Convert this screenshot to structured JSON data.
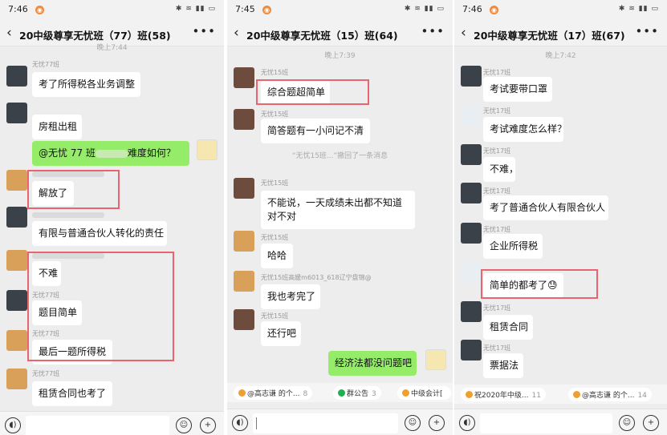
{
  "screens": [
    {
      "status_time": "7:46",
      "title": "20中级尊享无忧班（77）班(58)",
      "timestamp": "晚上7:44",
      "messages": [
        {
          "sender": "无忧77班",
          "text": "考了所得税各业务调整"
        },
        {
          "sender": "",
          "text": "房租出租"
        },
        {
          "sender": "",
          "text_before": "@无忧 77 班",
          "text_after": "难度如何？",
          "mine": true
        },
        {
          "sender": "",
          "text": "解放了"
        },
        {
          "sender": "",
          "text": "有限与普通合伙人转化的责任"
        },
        {
          "sender": "",
          "text": "不难"
        },
        {
          "sender": "无忧77班",
          "text": "题目简单"
        },
        {
          "sender": "无忧77班",
          "text": "最后一题所得税"
        },
        {
          "sender": "无忧77班",
          "text": "租赁合同也考了"
        }
      ]
    },
    {
      "status_time": "7:45",
      "title": "20中级尊享无忧班（15）班(64)",
      "timestamp": "晚上7:39",
      "recall_notice": "“无忧15班...”撤回了一条消息",
      "messages": [
        {
          "sender": "无忧15班",
          "text": "综合题超简单"
        },
        {
          "sender": "无忧15班",
          "text": "简答题有一小问记不清"
        },
        {
          "sender": "无忧15班",
          "text": "不能说，一天成绩未出都不知道对不对"
        },
        {
          "sender": "无忧15班",
          "text": "哈哈"
        },
        {
          "sender": "无忧15班高媛m6013_618辽宁盘锦@",
          "text": "我也考完了"
        },
        {
          "sender": "无忧15班",
          "text": "还行吧"
        },
        {
          "sender": "",
          "text": "经济法都没问题吧",
          "mine": true
        }
      ],
      "chips": [
        {
          "label": "@高志谦 的个...",
          "count": "8"
        },
        {
          "label": "群公告",
          "count": "3"
        },
        {
          "label": "中级会计[",
          "count": ""
        }
      ]
    },
    {
      "status_time": "7:46",
      "title": "20中级尊享无忧班（17）班(67)",
      "timestamp": "晚上7:42",
      "messages": [
        {
          "sender": "无忧17班",
          "text": "考试要带口罩"
        },
        {
          "sender": "无忧17班",
          "text": "考试难度怎么样？"
        },
        {
          "sender": "无忧17班",
          "text": "不难，"
        },
        {
          "sender": "无忧17班",
          "text": "考了普通合伙人有限合伙人"
        },
        {
          "sender": "无忧17班",
          "text": "企业所得税"
        },
        {
          "sender": "",
          "text": "简单的都考了😓"
        },
        {
          "sender": "无忧17班",
          "text": "租赁合同"
        },
        {
          "sender": "无忧17班",
          "text": "票据法"
        }
      ],
      "chips": [
        {
          "label": "祝2020年中级...",
          "count": "11"
        },
        {
          "label": "@高志谦 的个...",
          "count": "14"
        }
      ]
    }
  ],
  "colors": {
    "bubble_mine": "#95ec69",
    "highlight_box": "#e8646f",
    "background": "#ededed"
  }
}
